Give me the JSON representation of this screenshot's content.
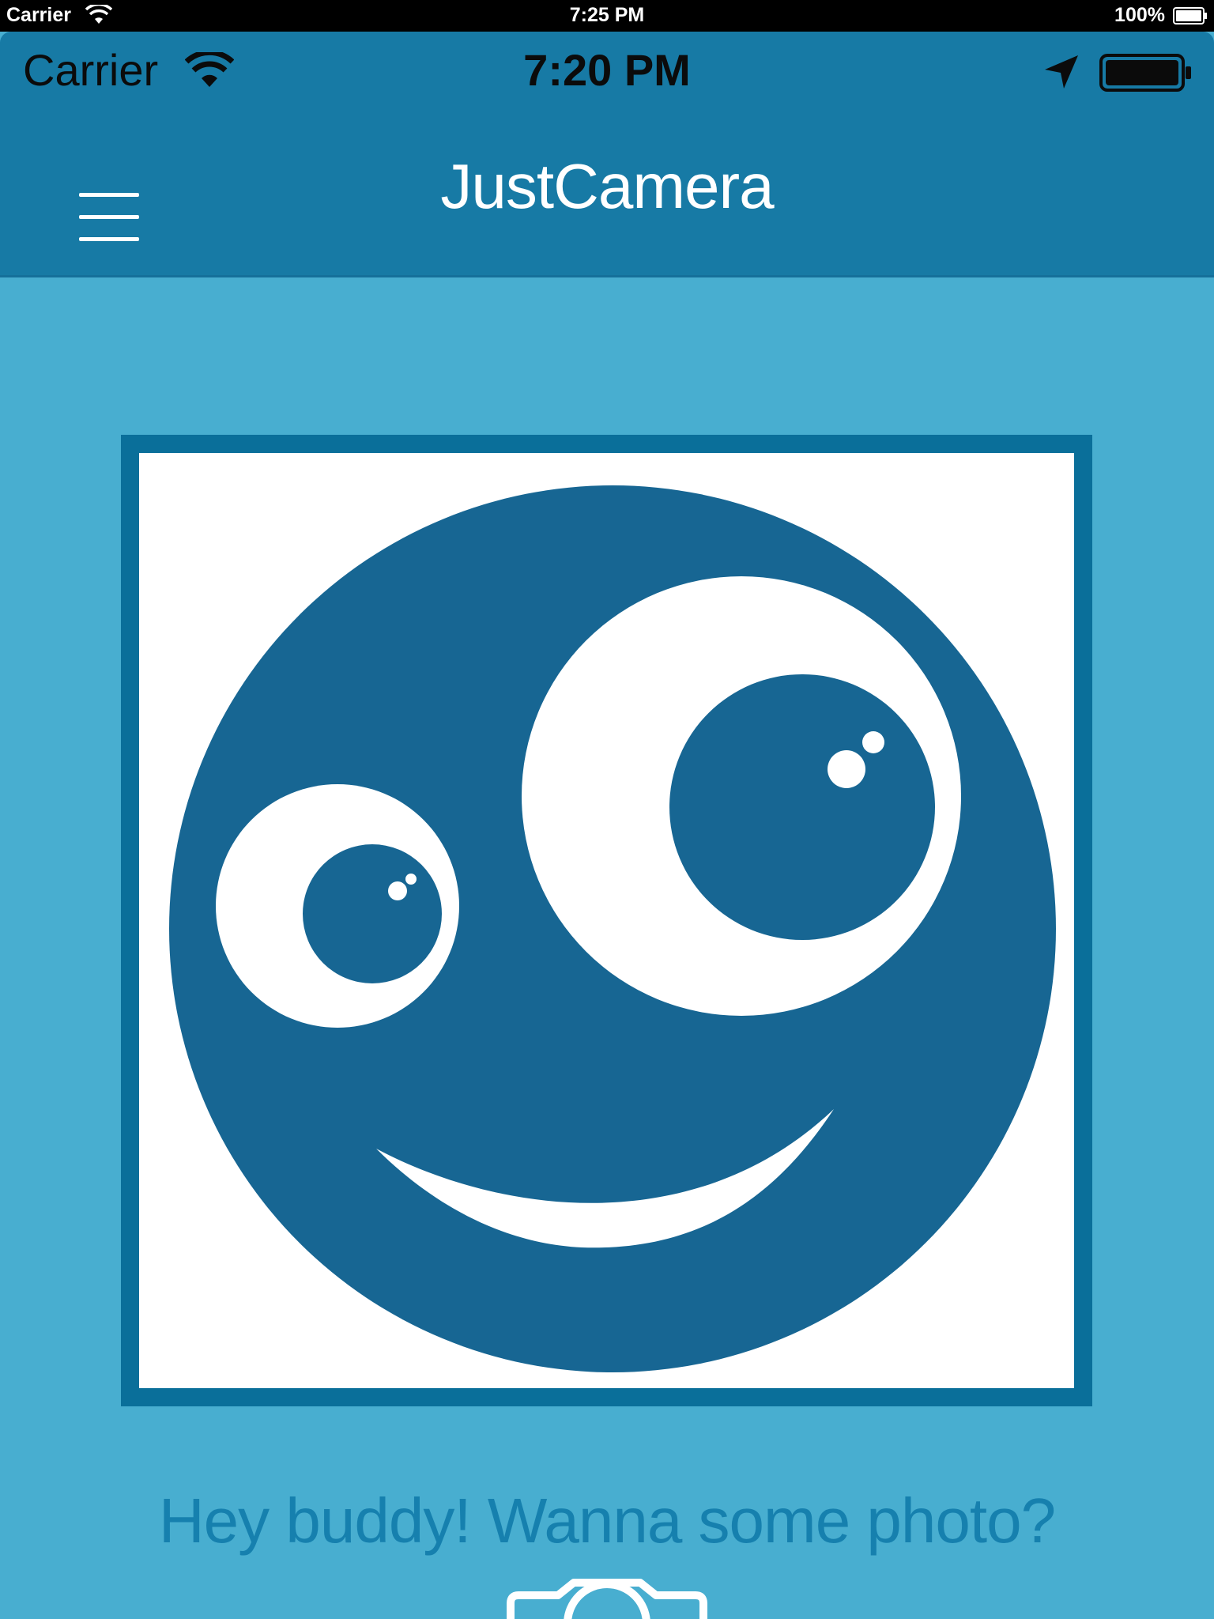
{
  "device_status": {
    "carrier": "Carrier",
    "time": "7:25 PM",
    "battery_percent": "100%"
  },
  "app_status": {
    "carrier": "Carrier",
    "time": "7:20 PM",
    "icons": [
      "wifi-icon",
      "location-arrow-icon",
      "battery-icon"
    ]
  },
  "header": {
    "title": "JustCamera",
    "menu_icon": "hamburger-menu-icon"
  },
  "photo": {
    "content": "smiley-face-logo"
  },
  "prompt": {
    "text": "Hey buddy! Wanna some photo?"
  },
  "camera_button": {
    "icon": "camera-icon"
  },
  "colors": {
    "background": "#48AED0",
    "header": "#177AA5",
    "frame_border": "#0A6F9A",
    "face": "#176693",
    "prompt_text": "#1680AE"
  }
}
